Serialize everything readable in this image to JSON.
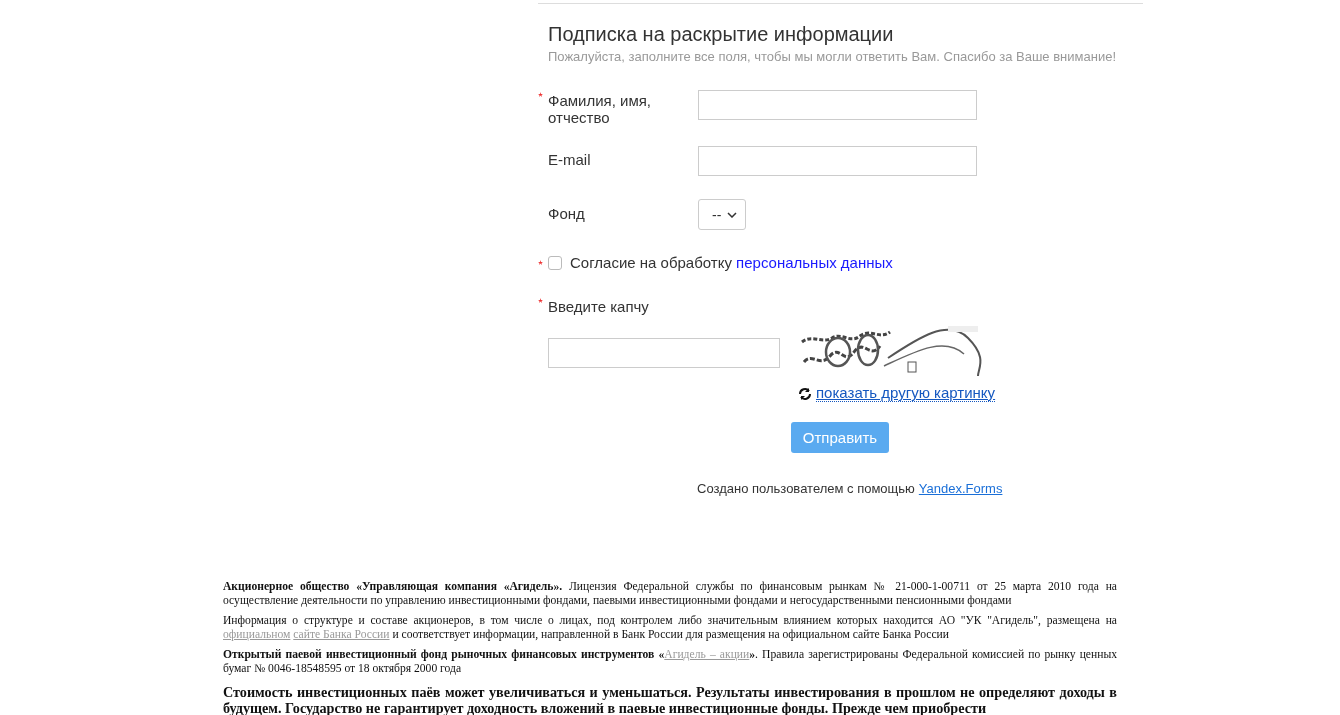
{
  "form": {
    "title": "Подписка на раскрытие информации",
    "subtitle": "Пожалуйста, заполните все поля, чтобы мы могли ответить Вам. Спасибо за Ваше внимание!",
    "fields": [
      {
        "kind": "text",
        "label": "Фамилия, имя, отчество",
        "required": true
      },
      {
        "kind": "text",
        "label": "E-mail",
        "required": false
      },
      {
        "kind": "select",
        "label": "Фонд",
        "required": false,
        "value": "--"
      }
    ],
    "consent": {
      "required": true,
      "checked": false,
      "text": "Согласие на обработку",
      "link": "персональных данных"
    },
    "captcha": {
      "label": "Введите капчу",
      "required": true,
      "refresh": "показать другую картинку"
    },
    "submit": "Отправить",
    "credit": {
      "text": "Создано пользователем с помощью",
      "link": "Yandex.Forms"
    }
  },
  "footer": {
    "paragraphs": [
      {
        "kind": "note",
        "parts": [
          {
            "kind": "bold",
            "text": "Акционерное общество «Управляющая компания «Агидель»."
          },
          {
            "kind": "plain",
            "text": " Лицензия Федеральной службы по финансовым рынкам №  21-000-1-00711 от  25 марта 2010 года на осуществление деятельности по управлению инвестиционными фондами, паевыми инвестиционными фондами и негосударственными пенсионными фондами"
          }
        ]
      },
      {
        "kind": "note",
        "parts": [
          {
            "kind": "plain",
            "text": "Информация о структуре и составе акционеров, в том числе о лицах, под контролем либо значительным влиянием которых находится АО \"УК \"Агидель\", размещена на "
          },
          {
            "kind": "link",
            "text": "официальном"
          },
          {
            "kind": "link",
            "text": "сайте Банка России"
          },
          {
            "kind": "plain",
            "text": " и соответствует информации, направленной в Банк России для размещения на официальном сайте Банка России"
          }
        ]
      },
      {
        "kind": "note",
        "parts": [
          {
            "kind": "bold",
            "text": "Открытый паевой инвестиционный фонд рыночных финансовых инструментов «"
          },
          {
            "kind": "link",
            "text": "Агидель – акции"
          },
          {
            "kind": "bold",
            "text": "»"
          },
          {
            "kind": "plain",
            "text": ". Правила зарегистрированы Федеральной комиссией по рынку ценных бумаг № 0046-18548595 от 18 октября 2000 года"
          }
        ]
      },
      {
        "kind": "warning",
        "parts": [
          {
            "kind": "bold",
            "text": "Стоимость инвестиционных паёв может увеличиваться и уменьшаться. Результаты инвестирования в прошлом не определяют доходы в будущем. Государство не гарантирует доходность вложений в паевые инвестиционные фонды. Прежде чем приобрести"
          }
        ]
      }
    ]
  }
}
